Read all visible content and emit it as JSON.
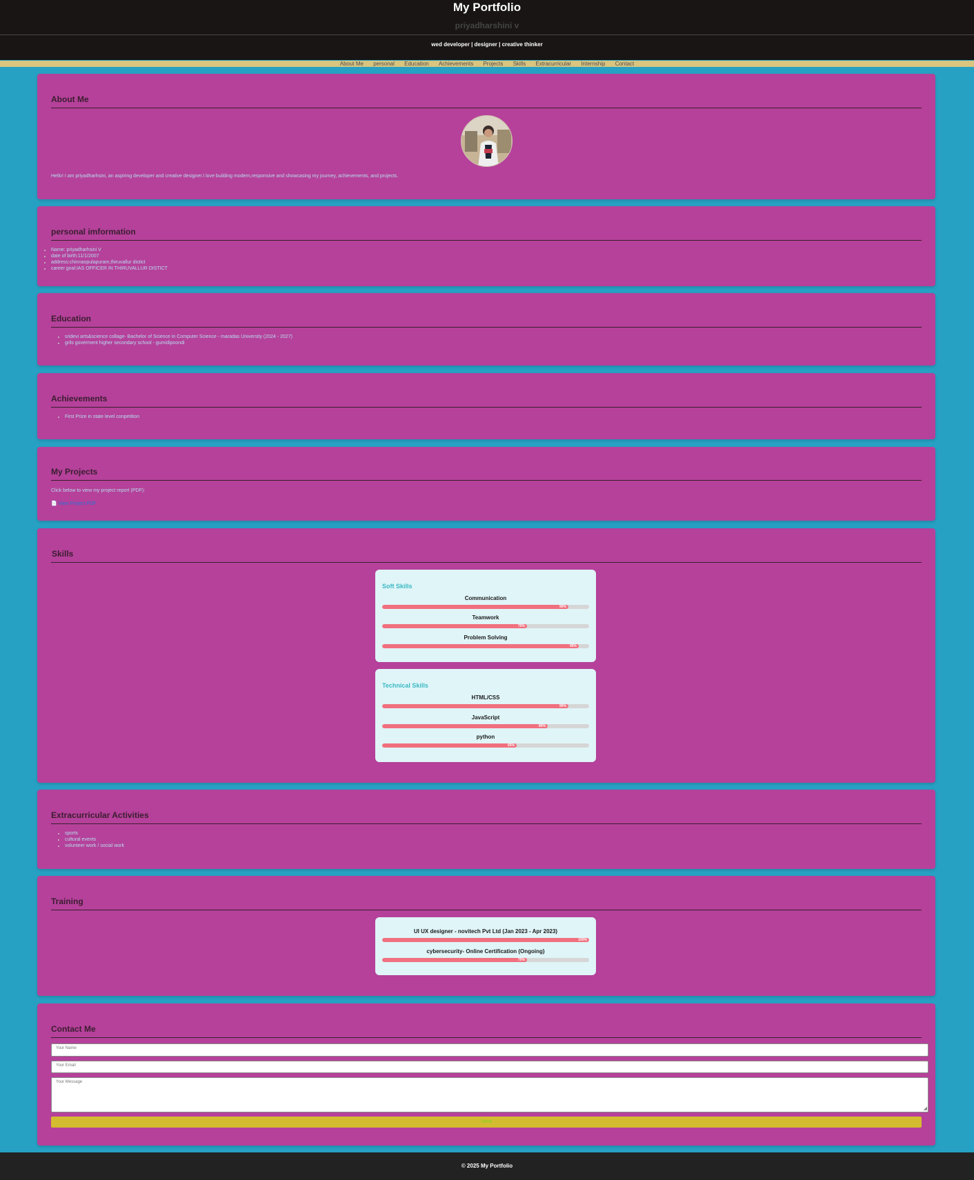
{
  "header": {
    "title": "My Portfolio",
    "name": "priyadharshini v",
    "tagline": "wed developer | designer | creative thinker"
  },
  "nav": [
    "About Me",
    "personal",
    "Education",
    "Achievements",
    "Projects",
    "Skills",
    "Extracurricular",
    "Internship",
    "Contact"
  ],
  "about": {
    "heading": "About Me",
    "text": "Hello! I am priyadharhsini, an aspiring developer and creative designer.I love building modern,responsive and showcasing my journey, achievements, and projects."
  },
  "personal": {
    "heading": "personal imformation",
    "items": [
      "Name: priyadharhsini V",
      "date of birth:11/1/2007",
      "address:chinnaopulapuram,thiruvallur distict",
      "career goal:IAS OFFICER IN THIRUVALLUR DISTICT"
    ]
  },
  "education": {
    "heading": "Education",
    "items": [
      "sridevi arts&science collage- Bachelor of Science in Computer Science - maradas University (2024 - 2027)",
      "grils goverment higher secondary school - gumidipoondi"
    ]
  },
  "achievements": {
    "heading": "Achievements",
    "items": [
      "First Prize in state level conpetition"
    ]
  },
  "projects": {
    "heading": "My Projects",
    "intro": "Click below to view my project report (PDF):",
    "link_icon": "📄",
    "link_label": "View Project PDF"
  },
  "skills": {
    "heading": "Skills",
    "soft": {
      "title": "Soft Skills",
      "items": [
        {
          "name": "Communication",
          "percent": 90,
          "label": "90%"
        },
        {
          "name": "Teamwork",
          "percent": 70,
          "label": "70%"
        },
        {
          "name": "Problem Solving",
          "percent": 95,
          "label": "95%"
        }
      ]
    },
    "technical": {
      "title": "Technical Skills",
      "items": [
        {
          "name": "HTML/CSS",
          "percent": 90,
          "label": "90%"
        },
        {
          "name": "JavaScript",
          "percent": 80,
          "label": "80%"
        },
        {
          "name": "python",
          "percent": 65,
          "label": "65%"
        }
      ]
    }
  },
  "extracurricular": {
    "heading": "Extracurricular Activities",
    "items": [
      "sports",
      "cultural events",
      "volunteer work / social work"
    ]
  },
  "training": {
    "heading": "Training",
    "items": [
      {
        "name": "UI UX designer - novitech Pvt Ltd (Jan 2023 - Apr 2023)",
        "percent": 100,
        "label": "100%"
      },
      {
        "name": "cybersecurity- Online Certification (Ongoing)",
        "percent": 70,
        "label": "70%"
      }
    ]
  },
  "contact": {
    "heading": "Contact Me",
    "name_placeholder": "Your Name",
    "email_placeholder": "Your Email",
    "message_placeholder": "Your Message",
    "send_label": "Send"
  },
  "footer": {
    "text": "© 2025 My Portfolio"
  },
  "colors": {
    "page_bg": "#27a1c3",
    "card_bg": "#b5419a",
    "header_bg": "#181514",
    "nav_bg": "#d9c57f",
    "bar_fill": "#f0707e",
    "send_button": "#d4bc30"
  }
}
